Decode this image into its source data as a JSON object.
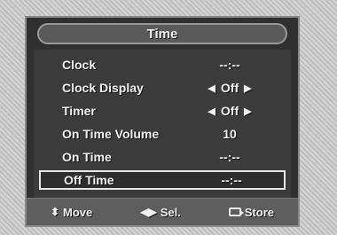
{
  "menu": {
    "title": "Time",
    "items": [
      {
        "label": "Clock",
        "value": "--:--",
        "has_arrows": false,
        "selected": false
      },
      {
        "label": "Clock Display",
        "value": "Off",
        "has_arrows": true,
        "selected": false
      },
      {
        "label": "Timer",
        "value": "Off",
        "has_arrows": true,
        "selected": false
      },
      {
        "label": "On Time Volume",
        "value": "10",
        "has_arrows": false,
        "selected": false
      },
      {
        "label": "On Time",
        "value": "--:--",
        "has_arrows": false,
        "selected": false
      },
      {
        "label": "Off Time",
        "value": "--:--",
        "has_arrows": false,
        "selected": true
      }
    ]
  },
  "footer": {
    "move_label": "Move",
    "sel_label": "Sel.",
    "store_label": "Store",
    "move_icon": "up-down-icon",
    "sel_icon": "left-right-icon",
    "store_icon": "enter-icon"
  },
  "colors": {
    "menu_bg": "#303030",
    "body_bg": "#3c3c3c",
    "text": "#f0f0f0",
    "footer_bg": "#5e5e5e"
  }
}
